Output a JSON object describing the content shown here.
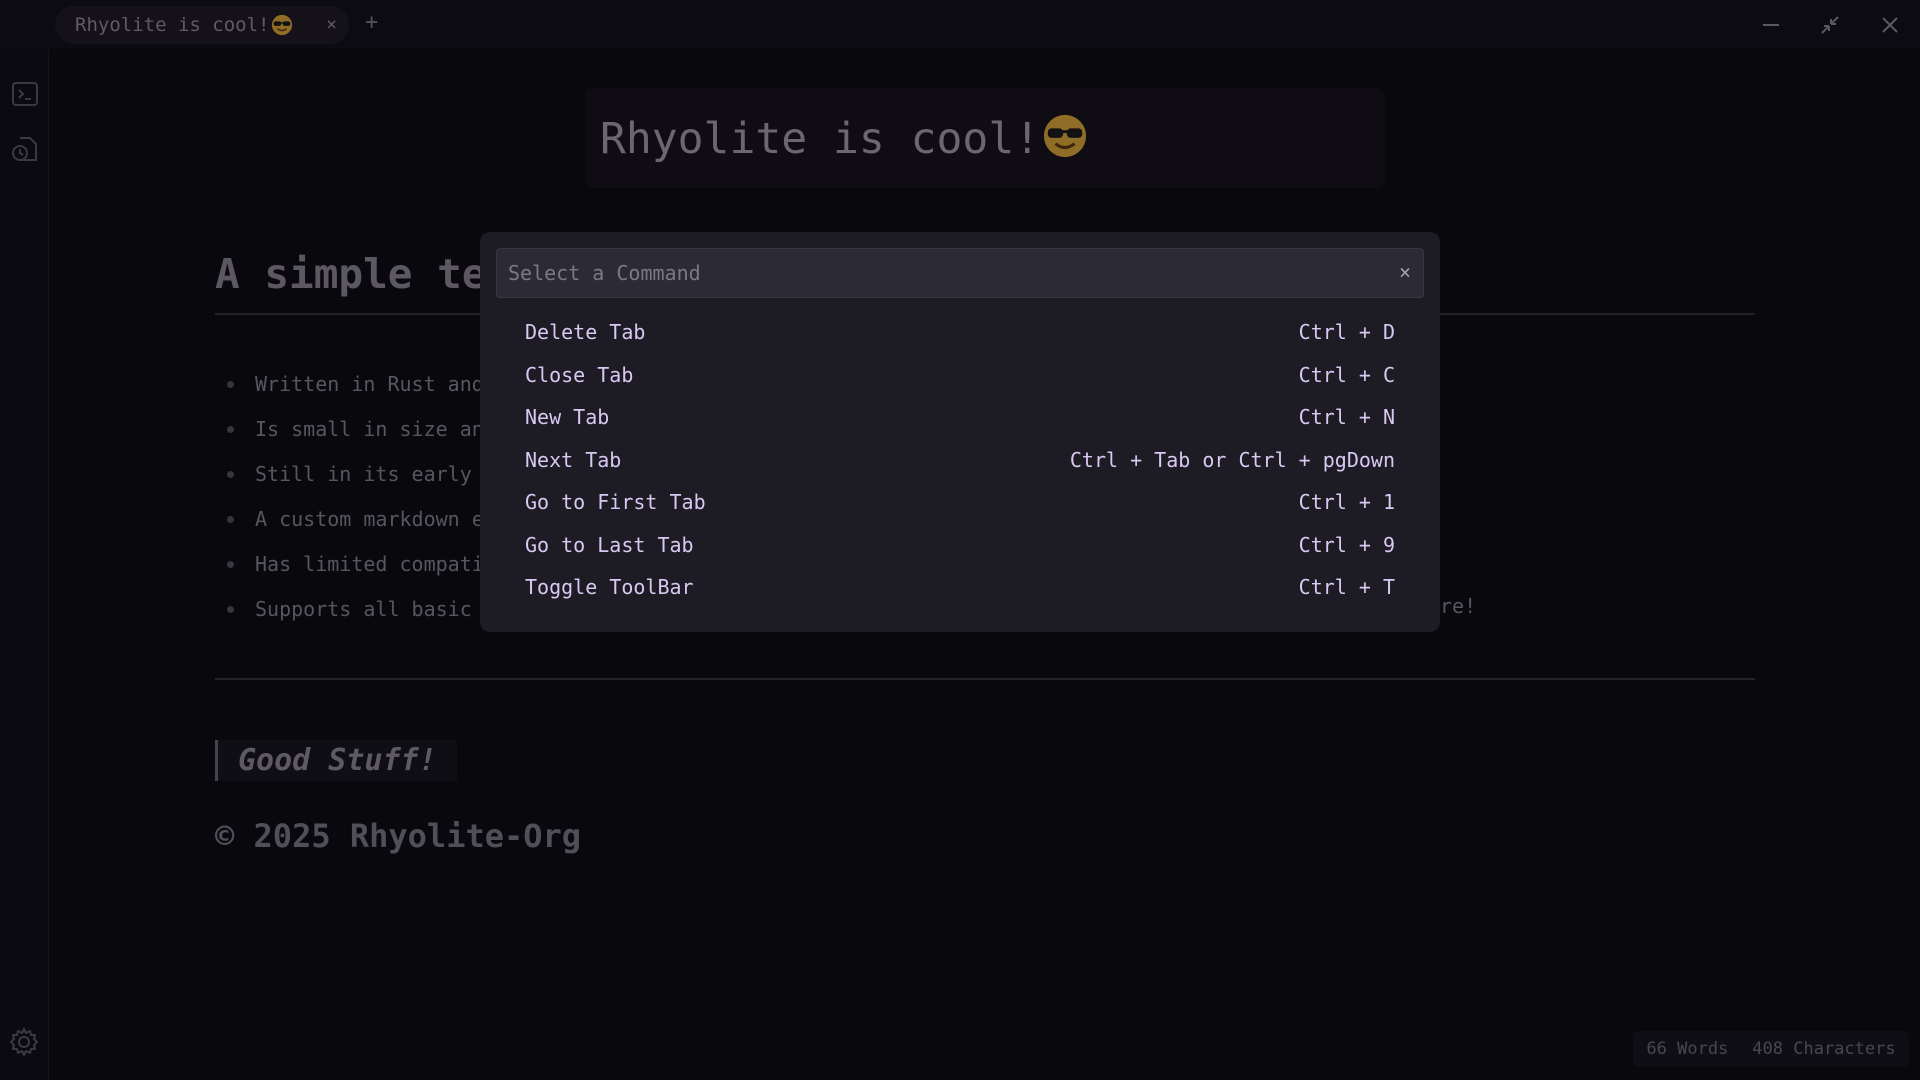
{
  "titlebar": {
    "tab": {
      "title": "Rhyolite is cool!",
      "emoji": "smiling-face-with-sunglasses",
      "close_label": "×"
    },
    "new_tab_label": "+",
    "window_controls": [
      "minimize-icon",
      "restore-icon",
      "close-icon"
    ]
  },
  "sidebar": {
    "items": [
      "terminal-icon",
      "file-history-icon"
    ],
    "settings_icon": "gear-icon"
  },
  "document": {
    "title": "Rhyolite is cool!",
    "title_emoji": "smiling-face-with-sunglasses",
    "heading": "A simple tex",
    "bullets": [
      "Written in Rust and",
      "Is small in size an",
      "Still in its early",
      "A custom markdown e",
      "Has limited compati",
      "Supports all basic"
    ],
    "bullet_tail": "re!",
    "quote": "Good Stuff!",
    "copyright": "© 2025 Rhyolite-Org"
  },
  "status": {
    "words": "66 Words",
    "characters": "408 Characters"
  },
  "command_palette": {
    "placeholder": "Select a Command",
    "clear_label": "×",
    "commands": [
      {
        "label": "Delete Tab",
        "shortcut": "Ctrl + D"
      },
      {
        "label": "Close Tab",
        "shortcut": "Ctrl + C"
      },
      {
        "label": "New Tab",
        "shortcut": "Ctrl + N"
      },
      {
        "label": "Next Tab",
        "shortcut": "Ctrl + Tab or Ctrl + pgDown"
      },
      {
        "label": "Go to First Tab",
        "shortcut": "Ctrl + 1"
      },
      {
        "label": "Go to Last Tab",
        "shortcut": "Ctrl + 9"
      },
      {
        "label": "Toggle ToolBar",
        "shortcut": "Ctrl + T"
      }
    ]
  },
  "colors": {
    "background": "#0c0b10",
    "palette_bg": "#1d1b24",
    "command_text": "#d9c8f2",
    "emoji_yellow": "#d9a636"
  }
}
